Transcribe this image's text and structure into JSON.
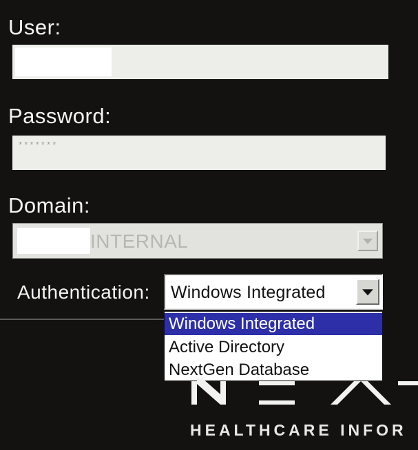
{
  "form": {
    "user_label": "User:",
    "password_label": "Password:",
    "password_mask": "*******",
    "domain_label": "Domain:",
    "domain_value": "INTERNAL",
    "auth_label": "Authentication:",
    "auth_selected": "Windows Integrated"
  },
  "auth_options": [
    {
      "label": "Windows Integrated",
      "selected": true
    },
    {
      "label": "Active Directory",
      "selected": false
    },
    {
      "label": "NextGen Database",
      "selected": false
    }
  ],
  "branding": {
    "tagline": "HEALTHCARE INFOR"
  },
  "colors": {
    "background": "#141210",
    "highlight": "#2d2fa8",
    "field": "#ededea"
  }
}
